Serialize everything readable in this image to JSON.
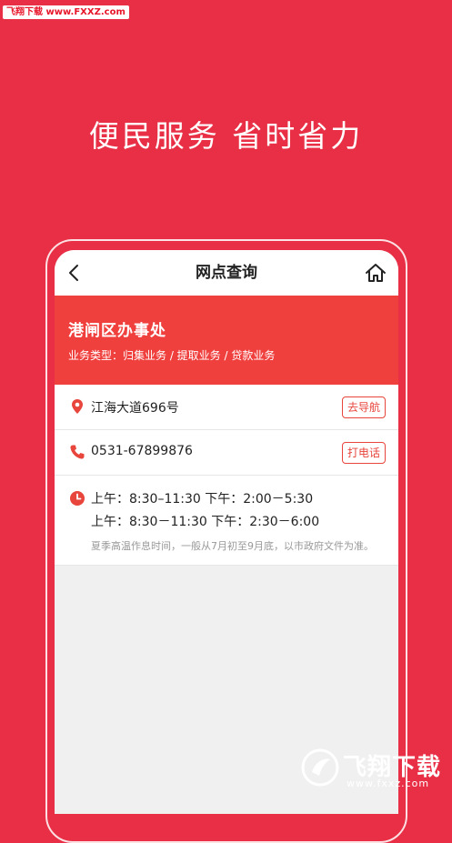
{
  "watermark_top": "飞翔下载 www.FXXZ.com",
  "slogan": "便民服务 省时省力",
  "nav": {
    "title": "网点查询",
    "back_icon": "chevron-left-icon",
    "home_icon": "home-icon"
  },
  "office": {
    "name": "港闸区办事处",
    "business": "业务类型：归集业务 / 提取业务 / 贷款业务"
  },
  "address": {
    "text": "江海大道696号",
    "action": "去导航",
    "icon": "location-pin-icon",
    "icon_color": "#e8453c"
  },
  "phone": {
    "text": "0531-67899876",
    "action": "打电话",
    "icon": "phone-icon",
    "icon_color": "#e8453c"
  },
  "hours": {
    "icon": "clock-icon",
    "line1": "上午：8:30–11:30  下午：2:00－5:30",
    "line2": "上午：8:30－11:30 下午：2:30－6:00",
    "note": "夏季高温作息时间，一般从7月初至9月底，以市政府文件为准。"
  },
  "watermark_bottom": {
    "title": "飞翔下载",
    "url": "www.fxxz.com"
  },
  "colors": {
    "background": "#e82f45",
    "hero": "#f0403e",
    "accent": "#e8453c"
  }
}
